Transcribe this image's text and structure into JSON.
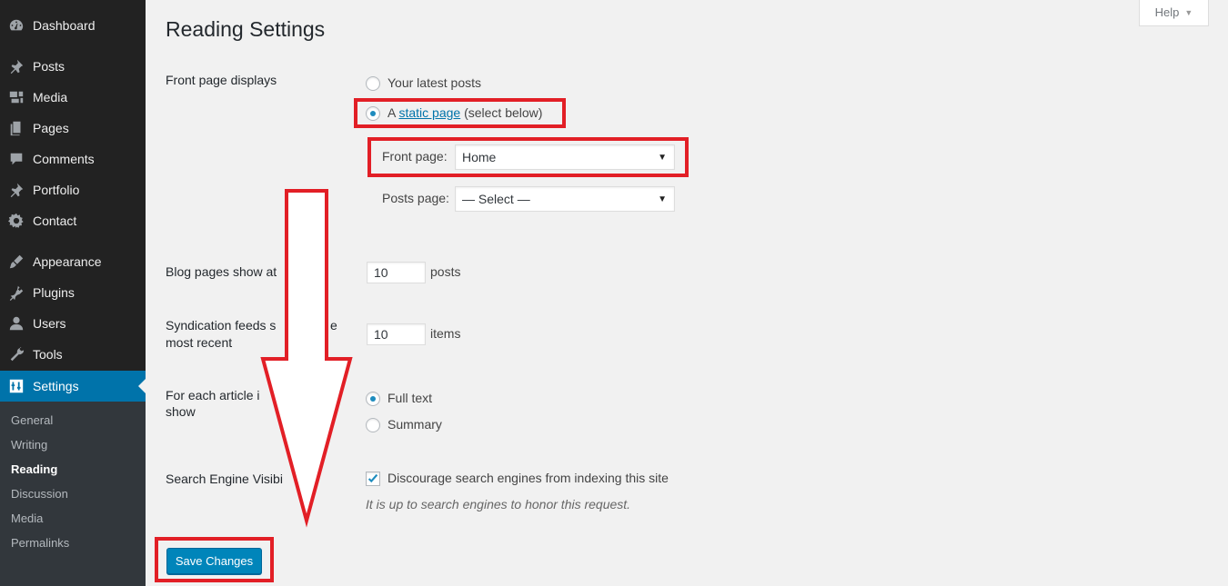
{
  "sidebar": {
    "menu": [
      {
        "label": "Dashboard",
        "icon": "dashboard-icon"
      },
      {
        "label": "Posts",
        "icon": "pin-icon"
      },
      {
        "label": "Media",
        "icon": "media-icon"
      },
      {
        "label": "Pages",
        "icon": "pages-icon"
      },
      {
        "label": "Comments",
        "icon": "comment-icon"
      },
      {
        "label": "Portfolio",
        "icon": "pin-icon"
      },
      {
        "label": "Contact",
        "icon": "gear-icon"
      },
      {
        "label": "Appearance",
        "icon": "brush-icon"
      },
      {
        "label": "Plugins",
        "icon": "plug-icon"
      },
      {
        "label": "Users",
        "icon": "user-icon"
      },
      {
        "label": "Tools",
        "icon": "wrench-icon"
      },
      {
        "label": "Settings",
        "icon": "settings-sliders-icon",
        "current": true
      }
    ],
    "submenu": [
      {
        "label": "General"
      },
      {
        "label": "Writing"
      },
      {
        "label": "Reading",
        "active": true
      },
      {
        "label": "Discussion"
      },
      {
        "label": "Media"
      },
      {
        "label": "Permalinks"
      }
    ]
  },
  "help": {
    "label": "Help"
  },
  "page": {
    "title": "Reading Settings"
  },
  "front_page": {
    "label": "Front page displays",
    "option_latest": "Your latest posts",
    "option_static_prefix": "A",
    "option_static_link": "static page",
    "option_static_suffix": "(select below)",
    "selected": "static",
    "front_page_label": "Front page:",
    "front_page_value": "Home",
    "posts_page_label": "Posts page:",
    "posts_page_value": "— Select —"
  },
  "blog_pages": {
    "label": "Blog pages show at",
    "value": "10",
    "unit": "posts"
  },
  "syndication": {
    "label_line1": "Syndication feeds s",
    "label_line1_suffix": "e",
    "label_line2": "most recent",
    "value": "10",
    "unit": "items"
  },
  "article_feed": {
    "label_line1": "For each article i",
    "label_line2": "show",
    "option_full": "Full text",
    "option_summary": "Summary",
    "selected": "full"
  },
  "search_visibility": {
    "label": "Search Engine Visibi",
    "checkbox_label": "Discourage search engines from indexing this site",
    "checked": true,
    "description": "It is up to search engines to honor this request."
  },
  "save_button": {
    "label": "Save Changes"
  },
  "colors": {
    "sidebar_bg": "#222222",
    "accent": "#0073aa",
    "highlight": "#e21f26",
    "button": "#0085ba"
  }
}
